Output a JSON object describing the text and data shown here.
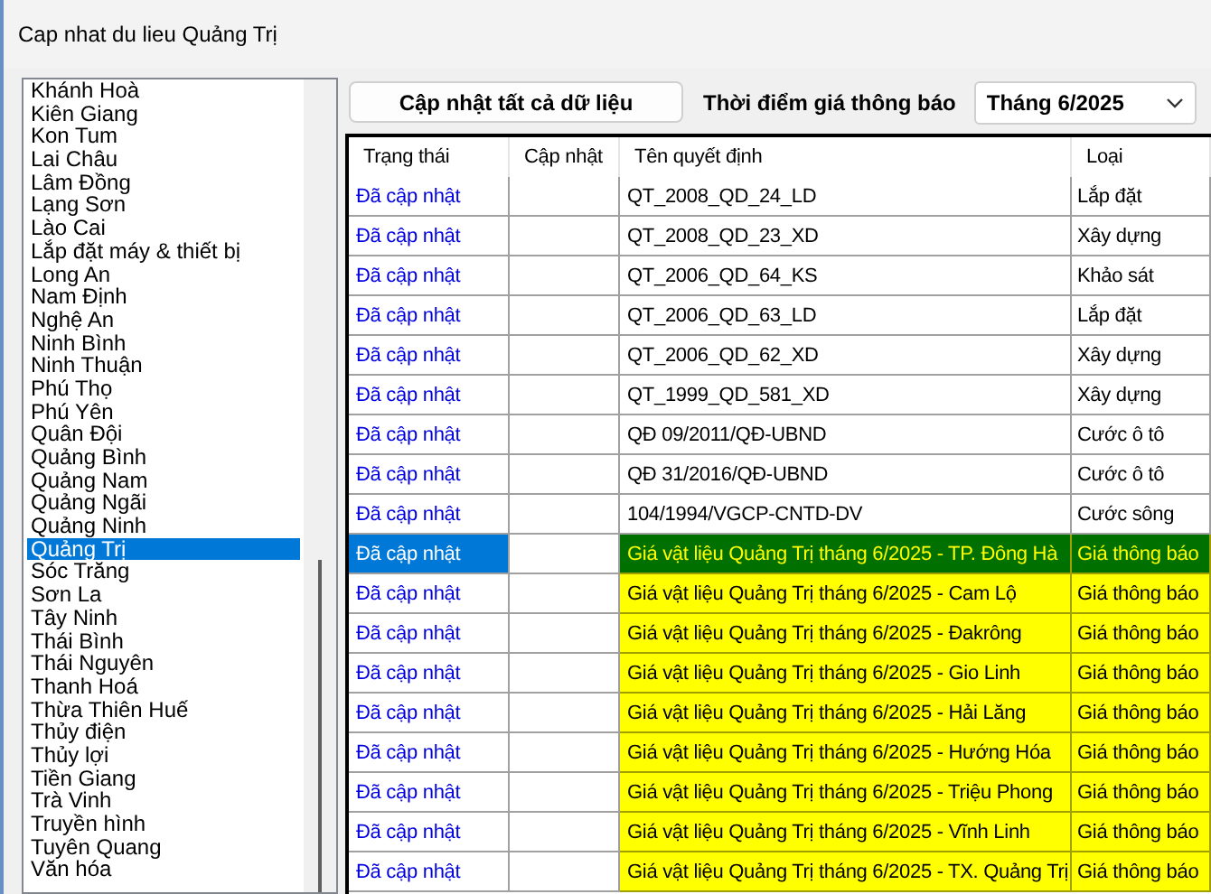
{
  "window": {
    "title": "Cap nhat du lieu Quảng Trị"
  },
  "provinces": [
    {
      "label": "Khánh Hoà",
      "selected": false
    },
    {
      "label": "Kiên Giang",
      "selected": false
    },
    {
      "label": "Kon Tum",
      "selected": false
    },
    {
      "label": "Lai Châu",
      "selected": false
    },
    {
      "label": "Lâm Đồng",
      "selected": false
    },
    {
      "label": "Lạng Sơn",
      "selected": false
    },
    {
      "label": "Lào Cai",
      "selected": false
    },
    {
      "label": "Lắp đặt máy & thiết bị",
      "selected": false
    },
    {
      "label": "Long An",
      "selected": false
    },
    {
      "label": "Nam Định",
      "selected": false
    },
    {
      "label": "Nghệ An",
      "selected": false
    },
    {
      "label": "Ninh Bình",
      "selected": false
    },
    {
      "label": "Ninh Thuận",
      "selected": false
    },
    {
      "label": "Phú Thọ",
      "selected": false
    },
    {
      "label": "Phú Yên",
      "selected": false
    },
    {
      "label": "Quân Đội",
      "selected": false
    },
    {
      "label": "Quảng Bình",
      "selected": false
    },
    {
      "label": "Quảng Nam",
      "selected": false
    },
    {
      "label": "Quảng Ngãi",
      "selected": false
    },
    {
      "label": "Quảng Ninh",
      "selected": false
    },
    {
      "label": "Quảng Trị",
      "selected": true
    },
    {
      "label": "Sóc Trăng",
      "selected": false
    },
    {
      "label": "Sơn La",
      "selected": false
    },
    {
      "label": "Tây Ninh",
      "selected": false
    },
    {
      "label": "Thái Bình",
      "selected": false
    },
    {
      "label": "Thái Nguyên",
      "selected": false
    },
    {
      "label": "Thanh Hoá",
      "selected": false
    },
    {
      "label": "Thừa Thiên Huế",
      "selected": false
    },
    {
      "label": "Thủy điện",
      "selected": false
    },
    {
      "label": "Thủy lợi",
      "selected": false
    },
    {
      "label": "Tiền Giang",
      "selected": false
    },
    {
      "label": "Trà Vinh",
      "selected": false
    },
    {
      "label": "Truyền hình",
      "selected": false
    },
    {
      "label": "Tuyên Quang",
      "selected": false
    },
    {
      "label": "Văn hóa",
      "selected": false
    }
  ],
  "toolbar": {
    "update_all_button": "Cập nhật tất cả dữ liệu",
    "period_label": "Thời điểm giá thông báo",
    "period_value": "Tháng 6/2025"
  },
  "table": {
    "columns": [
      "Trạng thái",
      "Cập nhật",
      "Tên quyết định",
      "Loại"
    ],
    "rows": [
      {
        "status": "Đã cập nhật",
        "update": "",
        "name": "QT_2008_QD_24_LD",
        "type": "Lắp đặt",
        "highlighted": false,
        "selected": false
      },
      {
        "status": "Đã cập nhật",
        "update": "",
        "name": "QT_2008_QD_23_XD",
        "type": "Xây dựng",
        "highlighted": false,
        "selected": false
      },
      {
        "status": "Đã cập nhật",
        "update": "",
        "name": "QT_2006_QD_64_KS",
        "type": "Khảo sát",
        "highlighted": false,
        "selected": false
      },
      {
        "status": "Đã cập nhật",
        "update": "",
        "name": "QT_2006_QD_63_LD",
        "type": "Lắp đặt",
        "highlighted": false,
        "selected": false
      },
      {
        "status": "Đã cập nhật",
        "update": "",
        "name": "QT_2006_QD_62_XD",
        "type": "Xây dựng",
        "highlighted": false,
        "selected": false
      },
      {
        "status": "Đã cập nhật",
        "update": "",
        "name": "QT_1999_QD_581_XD",
        "type": "Xây dựng",
        "highlighted": false,
        "selected": false
      },
      {
        "status": "Đã cập nhật",
        "update": "",
        "name": "QĐ 09/2011/QĐ-UBND",
        "type": "Cước ô tô",
        "highlighted": false,
        "selected": false
      },
      {
        "status": "Đã cập nhật",
        "update": "",
        "name": "QĐ 31/2016/QĐ-UBND",
        "type": "Cước ô tô",
        "highlighted": false,
        "selected": false
      },
      {
        "status": "Đã cập nhật",
        "update": "",
        "name": "104/1994/VGCP-CNTD-DV",
        "type": "Cước sông",
        "highlighted": false,
        "selected": false
      },
      {
        "status": "Đã cập nhật",
        "update": "",
        "name": "Giá vật liệu Quảng Trị tháng 6/2025 - TP. Đông Hà",
        "type": "Giá thông báo",
        "highlighted": true,
        "selected": true
      },
      {
        "status": "Đã cập nhật",
        "update": "",
        "name": "Giá vật liệu Quảng Trị tháng 6/2025 - Cam Lộ",
        "type": "Giá thông báo",
        "highlighted": true,
        "selected": false
      },
      {
        "status": "Đã cập nhật",
        "update": "",
        "name": "Giá vật liệu Quảng Trị tháng 6/2025 - Đakrông",
        "type": "Giá thông báo",
        "highlighted": true,
        "selected": false
      },
      {
        "status": "Đã cập nhật",
        "update": "",
        "name": "Giá vật liệu Quảng Trị tháng 6/2025 - Gio Linh",
        "type": "Giá thông báo",
        "highlighted": true,
        "selected": false
      },
      {
        "status": "Đã cập nhật",
        "update": "",
        "name": "Giá vật liệu Quảng Trị tháng 6/2025 - Hải Lăng",
        "type": "Giá thông báo",
        "highlighted": true,
        "selected": false
      },
      {
        "status": "Đã cập nhật",
        "update": "",
        "name": "Giá vật liệu Quảng Trị tháng 6/2025 - Hướng Hóa",
        "type": "Giá thông báo",
        "highlighted": true,
        "selected": false
      },
      {
        "status": "Đã cập nhật",
        "update": "",
        "name": "Giá vật liệu Quảng Trị tháng 6/2025 - Triệu Phong",
        "type": "Giá thông báo",
        "highlighted": true,
        "selected": false
      },
      {
        "status": "Đã cập nhật",
        "update": "",
        "name": "Giá vật liệu Quảng Trị tháng 6/2025 - Vĩnh Linh",
        "type": "Giá thông báo",
        "highlighted": true,
        "selected": false
      },
      {
        "status": "Đã cập nhật",
        "update": "",
        "name": "Giá vật liệu Quảng Trị tháng 6/2025 - TX. Quảng Trị",
        "type": "Giá thông báo",
        "highlighted": true,
        "selected": false
      }
    ]
  }
}
